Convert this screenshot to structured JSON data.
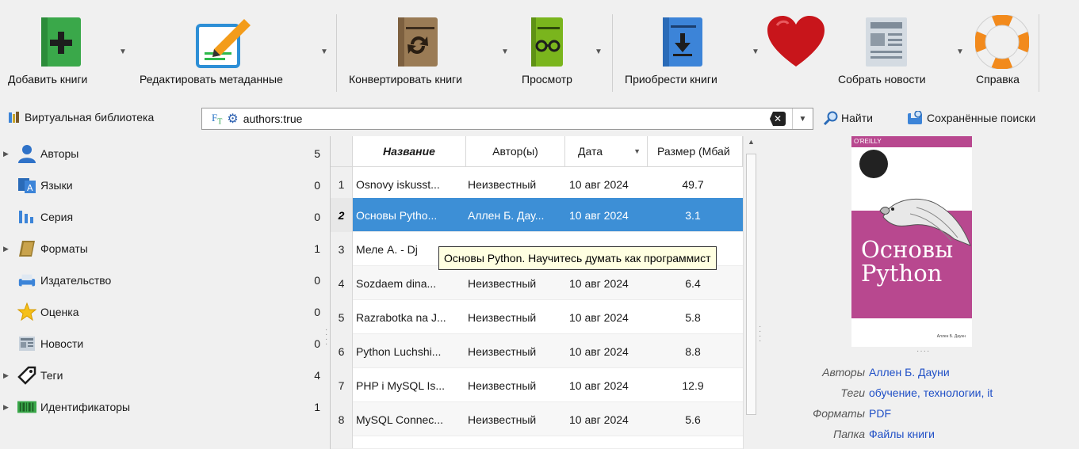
{
  "toolbar": {
    "add_books": "Добавить книги",
    "edit_metadata": "Редактировать метаданные",
    "convert_books": "Конвертировать книги",
    "view": "Просмотр",
    "get_books": "Приобрести книги",
    "fetch_news": "Собрать новости",
    "help": "Справка"
  },
  "searchbar": {
    "virtual_library": "Виртуальная библиотека",
    "query": "authors:true",
    "find": "Найти",
    "saved_searches": "Сохранённые поиски"
  },
  "tag_browser": {
    "items": [
      {
        "label": "Авторы",
        "count": "5",
        "expandable": true,
        "icon": "person-icon"
      },
      {
        "label": "Языки",
        "count": "0",
        "expandable": false,
        "icon": "languages-icon"
      },
      {
        "label": "Серия",
        "count": "0",
        "expandable": false,
        "icon": "series-icon"
      },
      {
        "label": "Форматы",
        "count": "1",
        "expandable": true,
        "icon": "book-icon"
      },
      {
        "label": "Издательство",
        "count": "0",
        "expandable": false,
        "icon": "publisher-icon"
      },
      {
        "label": "Оценка",
        "count": "0",
        "expandable": false,
        "icon": "star-icon"
      },
      {
        "label": "Новости",
        "count": "0",
        "expandable": false,
        "icon": "news-icon"
      },
      {
        "label": "Теги",
        "count": "4",
        "expandable": true,
        "icon": "tag-icon"
      },
      {
        "label": "Идентификаторы",
        "count": "1",
        "expandable": true,
        "icon": "barcode-icon"
      }
    ]
  },
  "book_list": {
    "columns": {
      "title": "Название",
      "author": "Автор(ы)",
      "date": "Дата",
      "size": "Размер (Мбай"
    },
    "rows": [
      {
        "num": "1",
        "title": "Osnovy iskusst...",
        "author": "Неизвестный",
        "date": "10 авг 2024",
        "size": "49.7"
      },
      {
        "num": "2",
        "title": "Основы Pytho...",
        "author": "Аллен Б. Дау...",
        "date": "10 авг 2024",
        "size": "3.1"
      },
      {
        "num": "3",
        "title": "Меле А. - Dj",
        "author": "",
        "date": "",
        "size": ""
      },
      {
        "num": "4",
        "title": "Sozdaem dina...",
        "author": "Неизвестный",
        "date": "10 авг 2024",
        "size": "6.4"
      },
      {
        "num": "5",
        "title": "Razrabotka na J...",
        "author": "Неизвестный",
        "date": "10 авг 2024",
        "size": "5.8"
      },
      {
        "num": "6",
        "title": "Python Luchshi...",
        "author": "Неизвестный",
        "date": "10 авг 2024",
        "size": "8.8"
      },
      {
        "num": "7",
        "title": "PHP i MySQL Is...",
        "author": "Неизвестный",
        "date": "10 авг 2024",
        "size": "12.9"
      },
      {
        "num": "8",
        "title": "MySQL Connec...",
        "author": "Неизвестный",
        "date": "10 авг 2024",
        "size": "5.6"
      }
    ],
    "tooltip": "Основы Python. Научитесь думать как программист"
  },
  "details": {
    "cover": {
      "publisher": "O'REILLY",
      "title_line1": "Основы",
      "title_line2": "Python",
      "author": "Аллен Б. Даунн"
    },
    "authors_key": "Авторы",
    "authors_val": "Аллен Б. Дауни",
    "tags_key": "Теги",
    "tags_val": "обучение, технологии, it",
    "formats_key": "Форматы",
    "formats_val": "PDF",
    "folder_key": "Папка",
    "folder_val": "Файлы книги"
  }
}
